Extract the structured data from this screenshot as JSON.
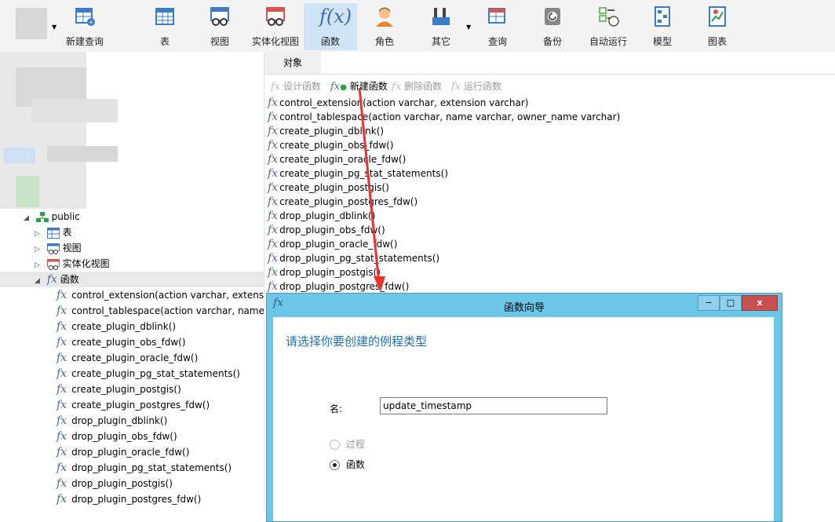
{
  "toolbar": {
    "items": [
      {
        "label": "新建查询"
      },
      {
        "label": "表"
      },
      {
        "label": "视图"
      },
      {
        "label": "实体化视图"
      },
      {
        "label": "函数"
      },
      {
        "label": "角色"
      },
      {
        "label": "其它"
      },
      {
        "label": "查询"
      },
      {
        "label": "备份"
      },
      {
        "label": "自动运行"
      },
      {
        "label": "模型"
      },
      {
        "label": "图表"
      }
    ],
    "active": "函数"
  },
  "tree": {
    "schema": "public",
    "nodes": [
      {
        "label": "表"
      },
      {
        "label": "视图"
      },
      {
        "label": "实体化视图"
      },
      {
        "label": "函数"
      }
    ],
    "functions": [
      "control_extension(action varchar, extensio",
      "control_tablespace(action varchar, name v",
      "create_plugin_dblink()",
      "create_plugin_obs_fdw()",
      "create_plugin_oracle_fdw()",
      "create_plugin_pg_stat_statements()",
      "create_plugin_postgis()",
      "create_plugin_postgres_fdw()",
      "drop_plugin_dblink()",
      "drop_plugin_obs_fdw()",
      "drop_plugin_oracle_fdw()",
      "drop_plugin_pg_stat_statements()",
      "drop_plugin_postgis()",
      "drop_plugin_postgres_fdw()"
    ]
  },
  "objects": {
    "tab": "对象",
    "actions": {
      "design": "设计函数",
      "new": "新建函数",
      "delete": "删除函数",
      "run": "运行函数"
    },
    "list": [
      "control_extension(action varchar, extension varchar)",
      "control_tablespace(action varchar, name varchar, owner_name varchar)",
      "create_plugin_dblink()",
      "create_plugin_obs_fdw()",
      "create_plugin_oracle_fdw()",
      "create_plugin_pg_stat_statements()",
      "create_plugin_postgis()",
      "create_plugin_postgres_fdw()",
      "drop_plugin_dblink()",
      "drop_plugin_obs_fdw()",
      "drop_plugin_oracle_fdw()",
      "drop_plugin_pg_stat_statements()",
      "drop_plugin_postgis()",
      "drop_plugin_postgres_fdw()"
    ]
  },
  "dialog": {
    "title": "函数向导",
    "heading": "请选择你要创建的例程类型",
    "name_label": "名:",
    "name_value": "update_timestamp",
    "options": [
      {
        "label": "过程",
        "selected": false,
        "enabled": false
      },
      {
        "label": "函数",
        "selected": true,
        "enabled": true
      }
    ],
    "minimize": "−",
    "maximize": "□",
    "close": "x"
  },
  "colors": {
    "dialog_frame": "#6bc6e8",
    "heading": "#1e6fb0",
    "annotation_arrow": "#e8322b",
    "fx_icon": "#4c6a8a"
  }
}
